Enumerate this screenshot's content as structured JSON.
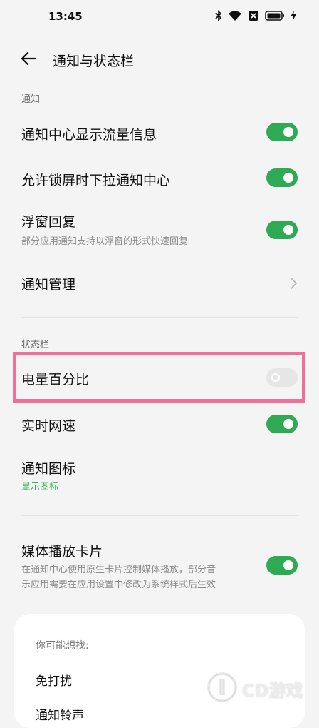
{
  "status_bar": {
    "time": "13:45",
    "icons": [
      "bluetooth-icon",
      "wifi-icon",
      "sim-off-icon",
      "battery-icon",
      "charging-icon"
    ]
  },
  "header": {
    "back_icon": "arrow-left-icon",
    "title": "通知与状态栏"
  },
  "sections": {
    "notify_label": "通知",
    "statusbar_label": "状态栏"
  },
  "rows": {
    "traffic": {
      "title": "通知中心显示流量信息",
      "enabled": true
    },
    "lockscreen": {
      "title": "允许锁屏时下拉通知中心",
      "enabled": true
    },
    "floating": {
      "title": "浮窗回复",
      "subtitle": "部分应用通知支持以浮窗的形式快速回复",
      "enabled": true
    },
    "manage": {
      "title": "通知管理",
      "icon": "chevron-right-icon"
    },
    "battery_percent": {
      "title": "电量百分比",
      "enabled": false
    },
    "net_speed": {
      "title": "实时网速",
      "enabled": true
    },
    "notify_icons": {
      "title": "通知图标",
      "subtitle": "显示图标"
    },
    "media_card": {
      "title": "媒体播放卡片",
      "subtitle_line1": "在通知中心使用原生卡片控制媒体播放，部分音",
      "subtitle_line2": "乐应用需要在应用设置中修改为系统样式后生效",
      "enabled": true
    }
  },
  "suggestions": {
    "heading": "你可能想找:",
    "items": [
      "免打扰",
      "通知铃声"
    ]
  },
  "watermark": {
    "logo": "cd-logo-icon",
    "text": "CD游戏"
  },
  "colors": {
    "toggle_on": "#2eaa55",
    "toggle_off": "#e6e6e6",
    "highlight": "#ee6f99",
    "accent_text": "#32b256",
    "background": "#f4f4f4"
  }
}
